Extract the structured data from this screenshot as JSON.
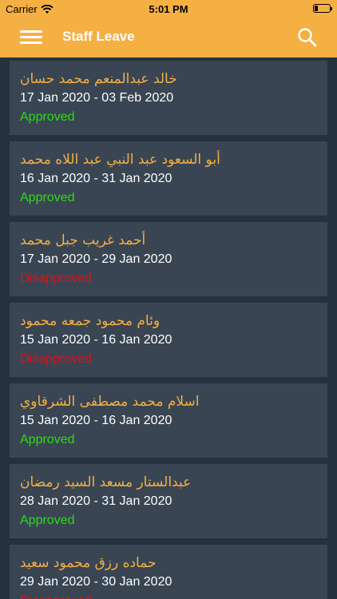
{
  "status_bar": {
    "carrier": "Carrier",
    "time": "5:01 PM",
    "battery_level": 0.2
  },
  "header": {
    "title": "Staff Leave",
    "menu_icon": "hamburger-menu-icon",
    "search_icon": "search-icon"
  },
  "colors": {
    "header_background": "#f5b043",
    "background": "#25313f",
    "card_background": "#394553",
    "name_color": "#f5b043",
    "approved_color": "#2ddb17",
    "disapproved_color": "#e0101a"
  },
  "leaves": [
    {
      "name": "خالد عبدالمنعم محمد حسان",
      "dates": "17 Jan 2020 - 03 Feb 2020",
      "status": "Approved"
    },
    {
      "name": "أبو السعود عبد النبي عبد اللاه محمد",
      "dates": "16 Jan 2020 - 31 Jan 2020",
      "status": "Approved"
    },
    {
      "name": "أحمد غريب جبل محمد",
      "dates": "17 Jan 2020 - 29 Jan 2020",
      "status": "Disapproved"
    },
    {
      "name": "وئام محمود جمعه محمود",
      "dates": "15 Jan 2020 - 16 Jan 2020",
      "status": "Disapproved"
    },
    {
      "name": "اسلام محمد مصطفى الشرقاوي",
      "dates": "15 Jan 2020 - 16 Jan 2020",
      "status": "Approved"
    },
    {
      "name": "عبدالستار مسعد السيد رمضان",
      "dates": "28 Jan 2020 - 31 Jan 2020",
      "status": "Approved"
    },
    {
      "name": "حماده رزق محمود سعيد",
      "dates": "29 Jan 2020 - 30 Jan 2020",
      "status": "Disapproved"
    }
  ]
}
